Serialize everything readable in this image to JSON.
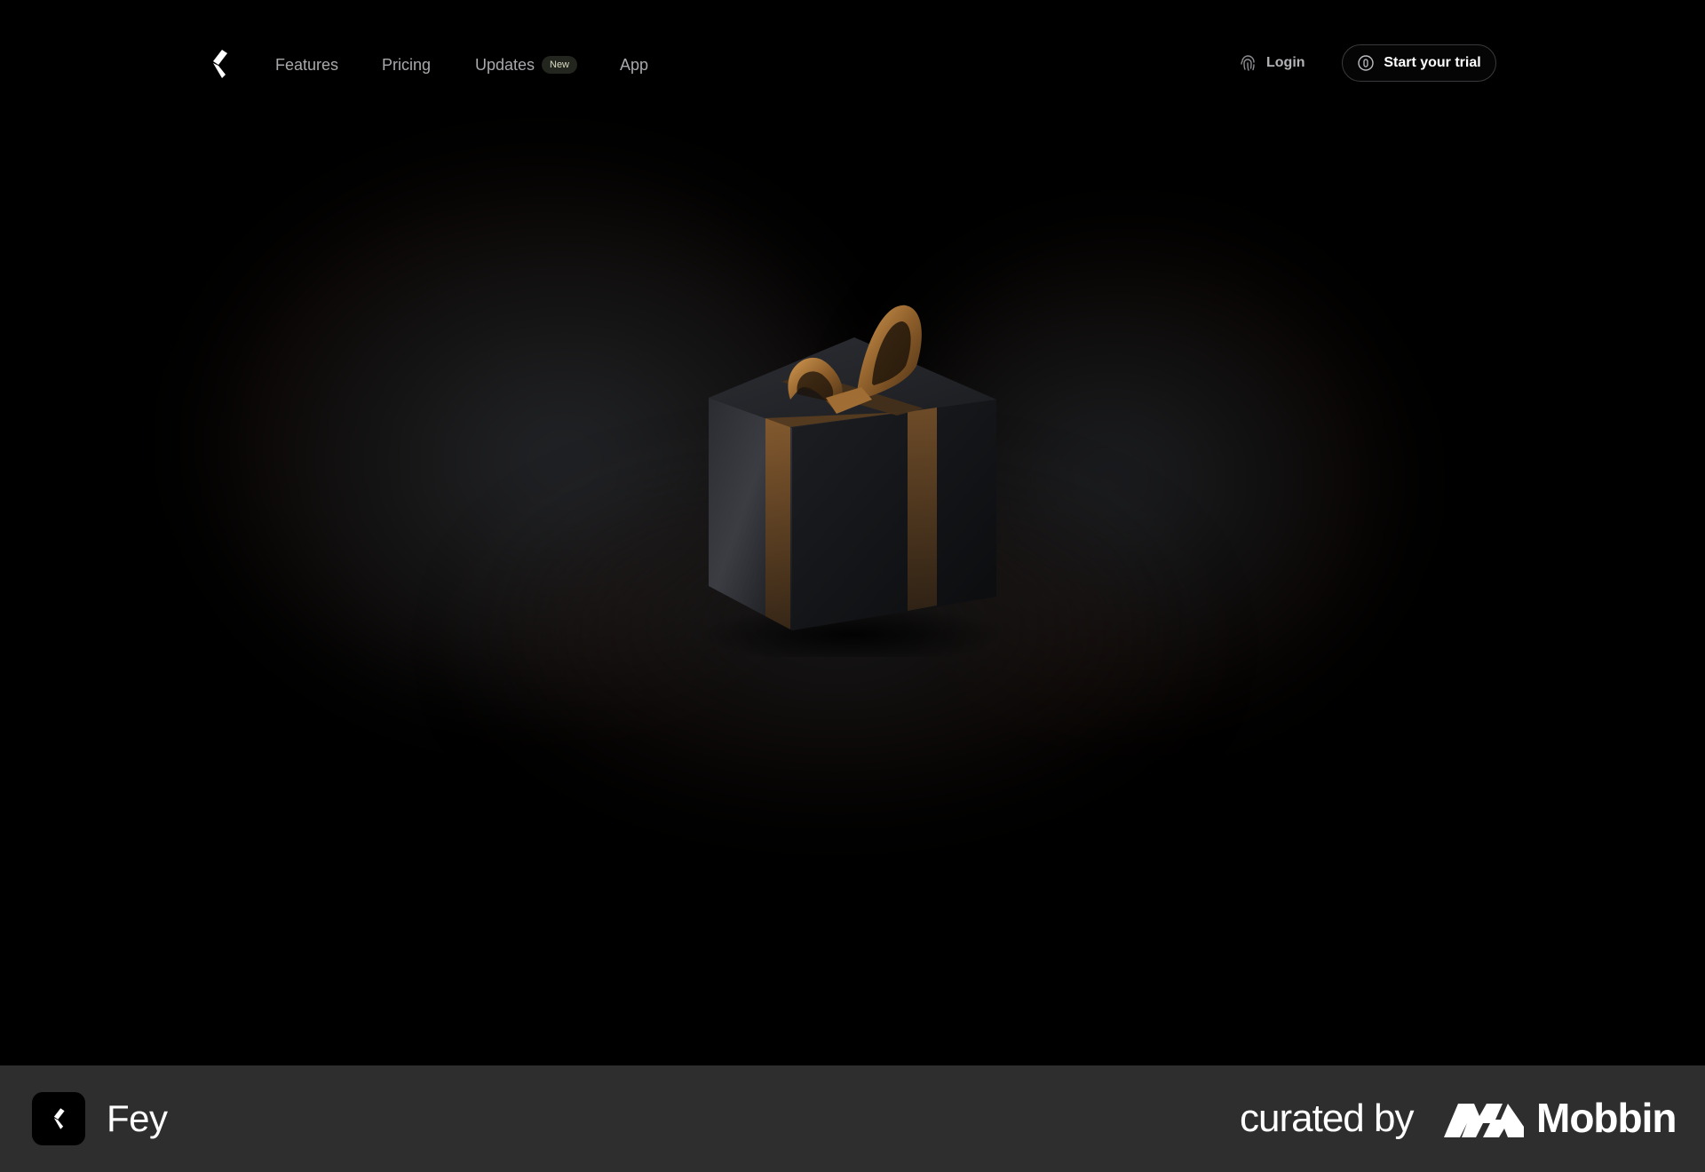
{
  "nav": {
    "logo_icon": "fey-logo-icon",
    "links": {
      "features": "Features",
      "pricing": "Pricing",
      "updates": "Updates",
      "app": "App"
    },
    "updates_badge": "New",
    "login": {
      "label": "Login",
      "icon": "fingerprint-icon"
    },
    "trial": {
      "label": "Start your trial",
      "icon": "shield-icon"
    }
  },
  "hero": {
    "illustration": "gift-box-illustration",
    "colors": {
      "background": "#000000",
      "ribbon": "#b07a3a",
      "box": "#1a1c20"
    }
  },
  "footer": {
    "app_name": "Fey",
    "app_icon": "fey-app-icon",
    "curated_by": "curated by",
    "brand": "Mobbin",
    "brand_icon": "mobbin-logo-icon",
    "background": "#2e2e2e"
  }
}
